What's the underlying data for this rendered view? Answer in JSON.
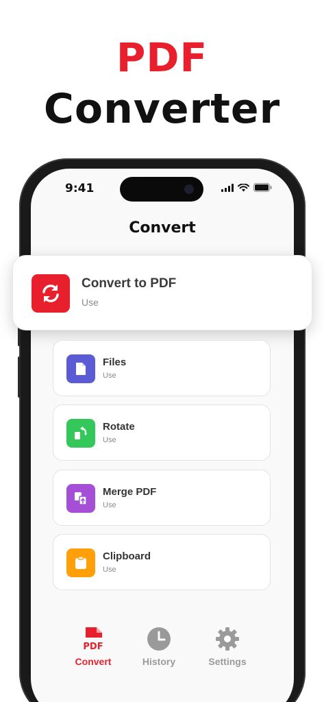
{
  "hero": {
    "line1": "PDF",
    "line2": "Converter"
  },
  "status_bar": {
    "time": "9:41"
  },
  "screen": {
    "title": "Convert"
  },
  "featured": {
    "title": "Convert to PDF",
    "subtitle": "Use",
    "icon": "convert-arrows-icon",
    "color": "#e8202d"
  },
  "items": [
    {
      "title": "Files",
      "subtitle": "Use",
      "icon": "file-icon",
      "color": "#5b5bd6"
    },
    {
      "title": "Rotate",
      "subtitle": "Use",
      "icon": "rotate-icon",
      "color": "#34c759"
    },
    {
      "title": "Merge PDF",
      "subtitle": "Use",
      "icon": "merge-icon",
      "color": "#a44fd6"
    },
    {
      "title": "Clipboard",
      "subtitle": "Use",
      "icon": "clipboard-icon",
      "color": "#ff9f0a"
    }
  ],
  "tabs": [
    {
      "label": "Convert",
      "icon_text": "PDF",
      "icon": "pdf-file-icon",
      "active": true
    },
    {
      "label": "History",
      "icon": "clock-icon",
      "active": false
    },
    {
      "label": "Settings",
      "icon": "gear-icon",
      "active": false
    }
  ],
  "colors": {
    "accent": "#e8202d",
    "inactive_tab": "#9a9a9a"
  }
}
